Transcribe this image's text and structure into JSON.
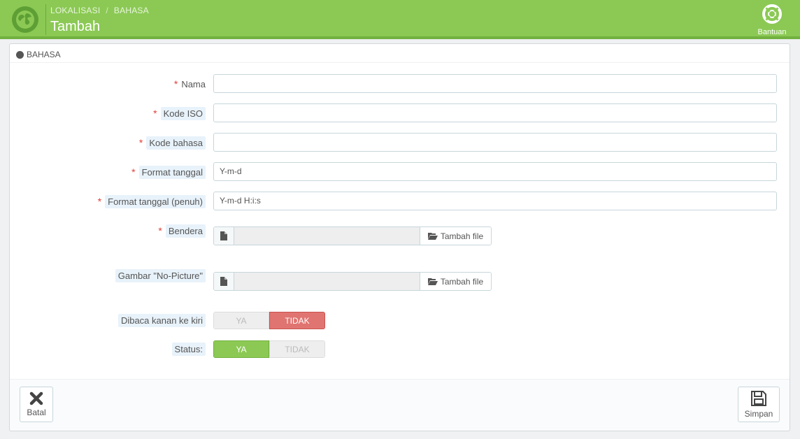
{
  "header": {
    "breadcrumb": [
      "LOKALISASI",
      "BAHASA"
    ],
    "breadcrumb_sep": "/",
    "title": "Tambah",
    "help_label": "Bantuan"
  },
  "panel": {
    "heading": "BAHASA"
  },
  "form": {
    "fields": [
      {
        "label": "Nama",
        "required": true,
        "value": ""
      },
      {
        "label": "Kode ISO",
        "required": true,
        "value": ""
      },
      {
        "label": "Kode bahasa",
        "required": true,
        "value": ""
      },
      {
        "label": "Format tanggal",
        "required": true,
        "value": "Y-m-d"
      },
      {
        "label": "Format tanggal (penuh)",
        "required": true,
        "value": "Y-m-d H:i:s"
      }
    ],
    "files": [
      {
        "label": "Bendera",
        "required": true,
        "button_label": "Tambah file"
      },
      {
        "label": "Gambar \"No-Picture\"",
        "required": false,
        "button_label": "Tambah file"
      }
    ],
    "switches": [
      {
        "label": "Dibaca kanan ke kiri",
        "yes_label": "YA",
        "no_label": "TIDAK",
        "selected": "TIDAK"
      },
      {
        "label": "Status:",
        "yes_label": "YA",
        "no_label": "TIDAK",
        "selected": "YA"
      }
    ],
    "required_mark": "*"
  },
  "footer": {
    "cancel_label": "Batal",
    "save_label": "Simpan"
  },
  "colors": {
    "header": "#8bc954",
    "required": "#e0403a",
    "switch_no_active": "#e07470",
    "switch_yes_active": "#8bc954"
  }
}
